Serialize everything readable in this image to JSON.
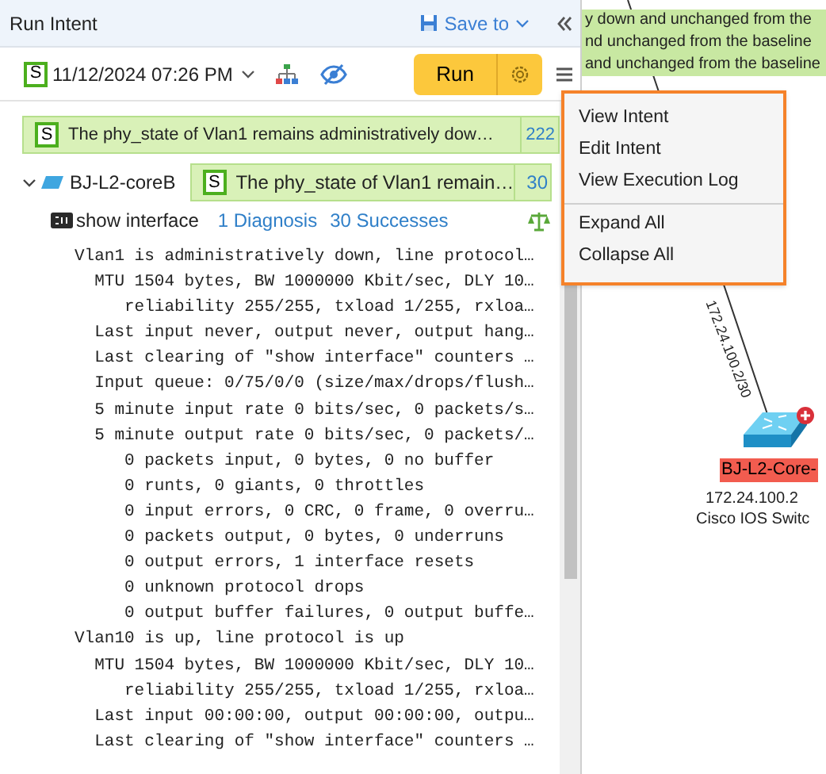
{
  "panel": {
    "title": "Run Intent",
    "save_button": "Save to"
  },
  "toolbar": {
    "status_badge": "S",
    "datetime": "11/12/2024 07:26 PM",
    "run_button": "Run"
  },
  "summary": {
    "badge": "S",
    "text": "The phy_state of Vlan1 remains administratively dow…",
    "count": "222"
  },
  "devices": [
    {
      "name": "BJ-L2-coreB",
      "expanded": true,
      "badge": "S",
      "text": "The phy_state of Vlan1 remain…",
      "count": "30",
      "commands": [
        {
          "name": "show interface",
          "diagnosis": "1 Diagnosis",
          "successes": "30 Successes",
          "output": [
            "Vlan1 is administratively down, line protocol…",
            "  MTU 1504 bytes, BW 1000000 Kbit/sec, DLY 10…",
            "     reliability 255/255, txload 1/255, rxloa…",
            "  Last input never, output never, output hang…",
            "  Last clearing of \"show interface\" counters …",
            "  Input queue: 0/75/0/0 (size/max/drops/flush…",
            "  5 minute input rate 0 bits/sec, 0 packets/s…",
            "  5 minute output rate 0 bits/sec, 0 packets/…",
            "     0 packets input, 0 bytes, 0 no buffer",
            "     0 runts, 0 giants, 0 throttles",
            "     0 input errors, 0 CRC, 0 frame, 0 overru…",
            "     0 packets output, 0 bytes, 0 underruns",
            "     0 output errors, 1 interface resets",
            "     0 unknown protocol drops",
            "     0 output buffer failures, 0 output buffe…",
            "Vlan10 is up, line protocol is up",
            "  MTU 1504 bytes, BW 1000000 Kbit/sec, DLY 10…",
            "     reliability 255/255, txload 1/255, rxloa…",
            "  Last input 00:00:00, output 00:00:00, outpu…",
            "  Last clearing of \"show interface\" counters …"
          ]
        }
      ]
    }
  ],
  "menu": {
    "groups": [
      [
        "View Intent",
        "Edit Intent",
        "View Execution Log"
      ],
      [
        "Expand All",
        "Collapse All"
      ]
    ]
  },
  "topology": {
    "highlights": [
      "y down and unchanged from the",
      "nd unchanged from the baseline",
      "and unchanged from the baseline"
    ],
    "link_label": "172.24.100.2/30",
    "device": {
      "name": "BJ-L2-Core-",
      "alert": true,
      "ip": "172.24.100.2",
      "type": "Cisco IOS Switc"
    }
  }
}
